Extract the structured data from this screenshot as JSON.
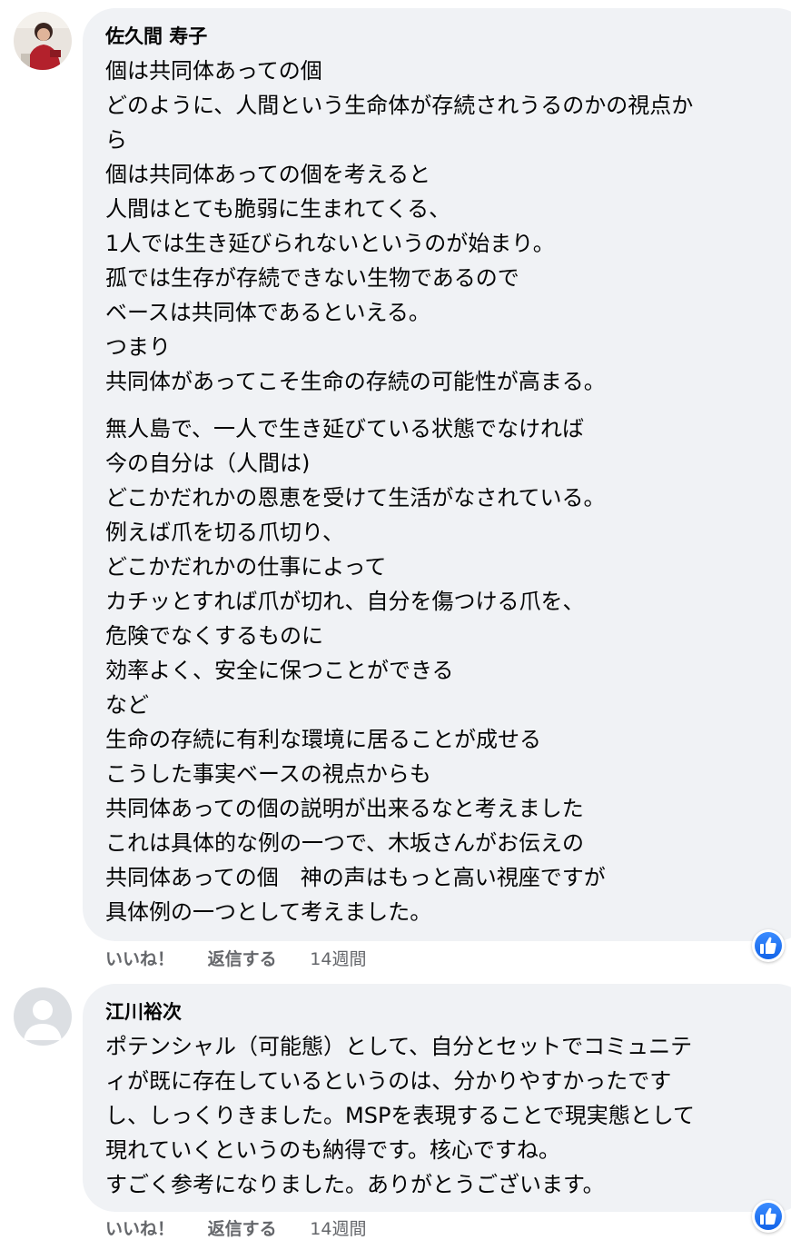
{
  "comments": [
    {
      "author": "佐久間 寿子",
      "paragraphs": [
        [
          "個は共同体あっての個",
          "どのように、人間という生命体が存続されうるのかの視点か",
          "ら",
          "個は共同体あっての個を考えると",
          "人間はとても脆弱に生まれてくる、",
          "1人では生き延びられないというのが始まり。",
          "孤では生存が存続できない生物であるので",
          "ベースは共同体であるといえる。",
          "つまり",
          "共同体があってこそ生命の存続の可能性が高まる。"
        ],
        [
          "無人島で、一人で生き延びている状態でなければ",
          "今の自分は（人間は)",
          "どこかだれかの恩恵を受けて生活がなされている。",
          "例えば爪を切る爪切り、",
          "どこかだれかの仕事によって",
          "カチッとすれば爪が切れ、自分を傷つける爪を、",
          "危険でなくするものに",
          "効率よく、安全に保つことができる",
          "など",
          "生命の存続に有利な環境に居ることが成せる",
          "こうした事実ベースの視点からも",
          "共同体あっての個の説明が出来るなと考えました",
          "これは具体的な例の一つで、木坂さんがお伝えの",
          "共同体あっての個　神の声はもっと高い視座ですが",
          "具体例の一つとして考えました。"
        ]
      ],
      "actions": {
        "like": "いいね！",
        "reply": "返信する",
        "time": "14週間"
      },
      "reaction_icon": "thumbs-up-icon"
    },
    {
      "author": "江川裕次",
      "lines": [
        "ポテンシャル（可能態）として、自分とセットでコミュニテ",
        "ィが既に存在しているというのは、分かりやすかったです",
        "し、しっくりきました。MSPを表現することで現実態として",
        "現れていくというのも納得です。核心ですね。",
        "すごく参考になりました。ありがとうございます。"
      ],
      "actions": {
        "like": "いいね！",
        "reply": "返信する",
        "time": "14週間"
      },
      "reaction_icon": "thumbs-up-icon"
    }
  ],
  "colors": {
    "bubble": "#f0f2f5",
    "meta_text": "#65676b",
    "like_blue": "#1877f2"
  }
}
